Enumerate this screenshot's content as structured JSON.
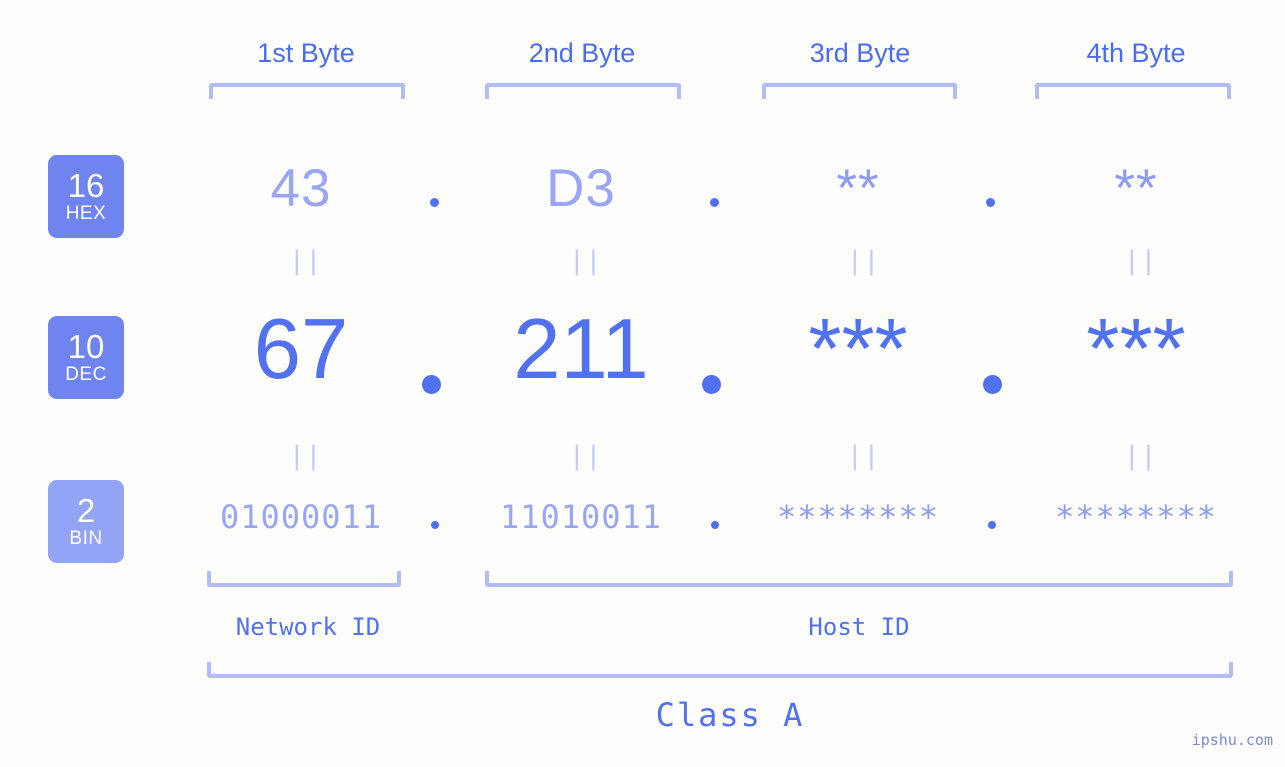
{
  "meta": {
    "watermark": "ipshu.com",
    "background": "#fdfefb",
    "accent_strong": "#5271f0",
    "accent_light": "#8d9bf2",
    "bracket_color": "#b4bcf7",
    "badge_color_strong": "#7084ef",
    "badge_color_light": "#93a4f6"
  },
  "headers": {
    "byte1": "1st Byte",
    "byte2": "2nd Byte",
    "byte3": "3rd Byte",
    "byte4": "4th Byte"
  },
  "badges": [
    {
      "number": "16",
      "name": "HEX"
    },
    {
      "number": "10",
      "name": "DEC"
    },
    {
      "number": "2",
      "name": "BIN"
    }
  ],
  "rows": {
    "hex": {
      "radix": "16",
      "label": "HEX",
      "values": [
        "43",
        "D3",
        "**",
        "**"
      ],
      "separator": "."
    },
    "dec": {
      "radix": "10",
      "label": "DEC",
      "values": [
        "67",
        "211",
        "***",
        "***"
      ],
      "separator": "."
    },
    "bin": {
      "radix": "2",
      "label": "BIN",
      "values": [
        "01000011",
        "11010011",
        "********",
        "********"
      ],
      "separator": "."
    }
  },
  "equality_marker": "||",
  "sections": {
    "network_id": "Network ID",
    "host_id": "Host ID",
    "class": "Class A"
  }
}
